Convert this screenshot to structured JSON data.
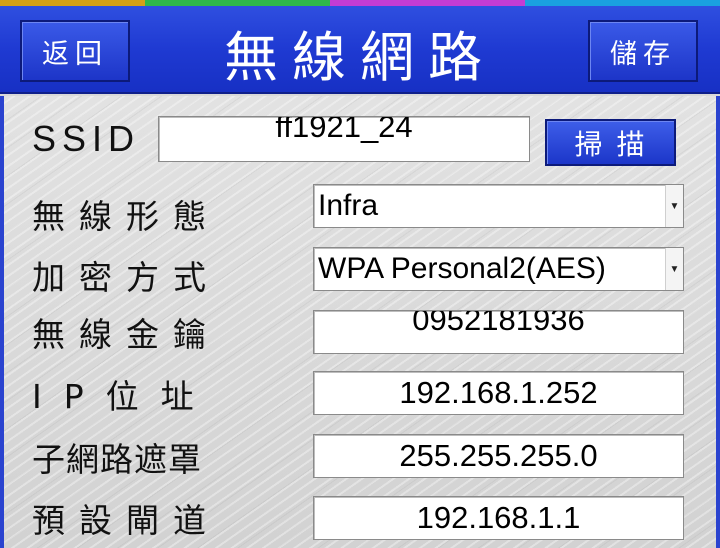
{
  "header": {
    "back_label": "返回",
    "title": "無線網路",
    "save_label": "儲存"
  },
  "top_strip_colors": [
    "#d4a017",
    "#2fb84a",
    "#2fb84a",
    "#c43cd4",
    "#c43cd4",
    "#1aa0e0"
  ],
  "form": {
    "ssid": {
      "label": "SSID",
      "value": "ff1921_24",
      "scan_label": "掃描"
    },
    "wireless_mode": {
      "label": "無線形態",
      "selected": "Infra"
    },
    "encryption": {
      "label": "加密方式",
      "selected": "WPA Personal2(AES)"
    },
    "wireless_key": {
      "label": "無線金鑰",
      "value": "0952181936"
    },
    "ip_address": {
      "label": "IP位址",
      "value": "192.168.1.252"
    },
    "subnet_mask": {
      "label": "子網路遮罩",
      "value": "255.255.255.0"
    },
    "gateway": {
      "label": "預設閘道",
      "value": "192.168.1.1"
    }
  },
  "colors": {
    "accent": "#1f3ad2",
    "panel_bg": "#d9d9d9"
  },
  "icons": {
    "dropdown_arrow": "chevron-down-icon"
  }
}
